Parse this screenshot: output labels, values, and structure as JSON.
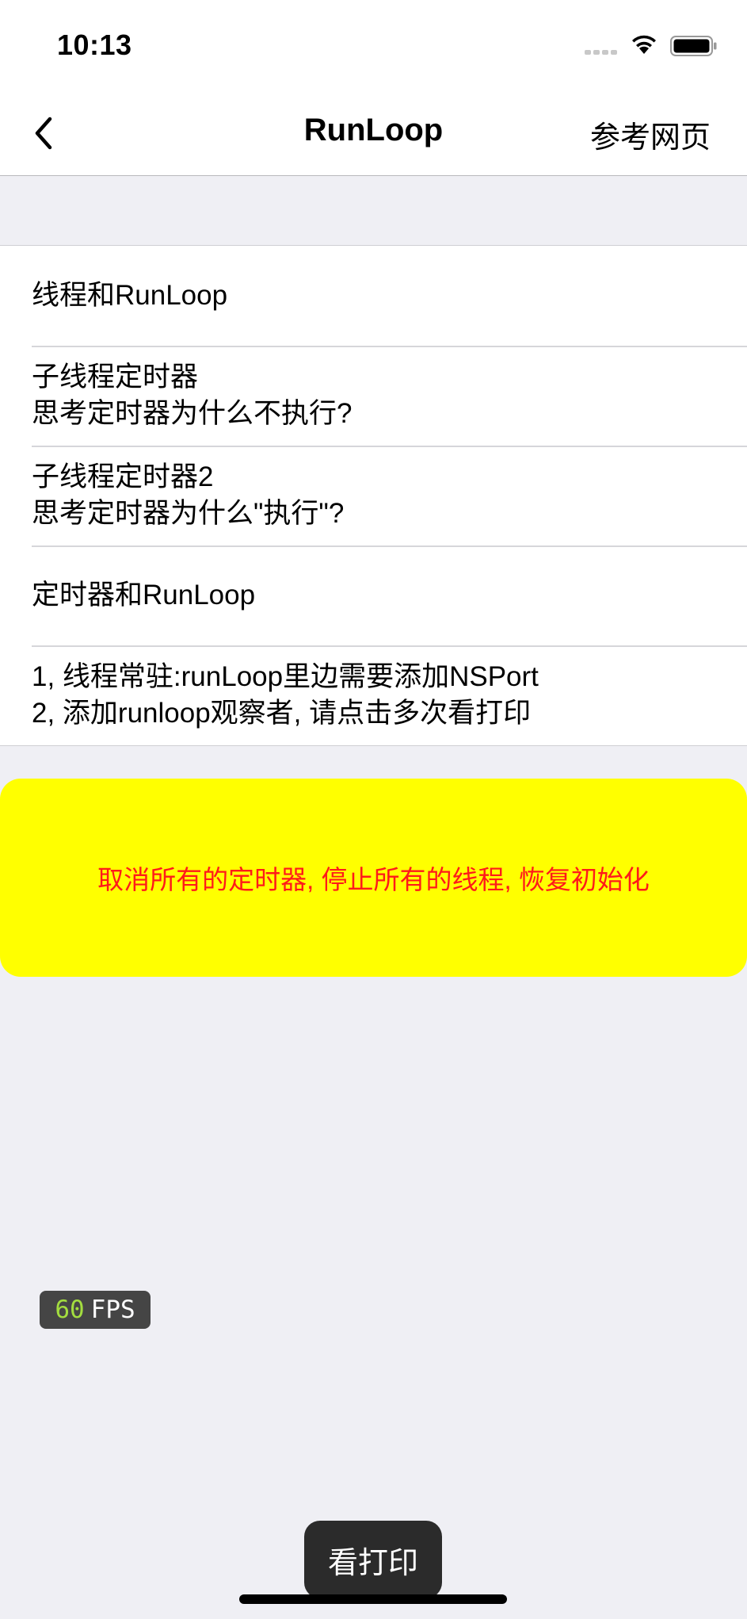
{
  "status_bar": {
    "time": "10:13",
    "icons": [
      "signal-icon",
      "wifi-icon",
      "battery-icon"
    ]
  },
  "nav": {
    "back_icon": "chevron-left-icon",
    "title": "RunLoop",
    "right_button": "参考网页"
  },
  "list": {
    "items": [
      {
        "line1": "线程和RunLoop",
        "line2": ""
      },
      {
        "line1": "子线程定时器",
        "line2": "思考定时器为什么不执行?"
      },
      {
        "line1": "子线程定时器2",
        "line2": "思考定时器为什么\"执行\"?"
      },
      {
        "line1": "定时器和RunLoop",
        "line2": ""
      },
      {
        "line1": "1, 线程常驻:runLoop里边需要添加NSPort",
        "line2": "2, 添加runloop观察者, 请点击多次看打印"
      }
    ]
  },
  "reset_button": {
    "label": "取消所有的定时器, 停止所有的线程, 恢复初始化",
    "background": "#ffff00",
    "text_color": "#ff1a1a"
  },
  "fps": {
    "value": "60",
    "unit": "FPS",
    "value_color": "#9bdc2c"
  },
  "print_button": {
    "label": "看打印"
  }
}
